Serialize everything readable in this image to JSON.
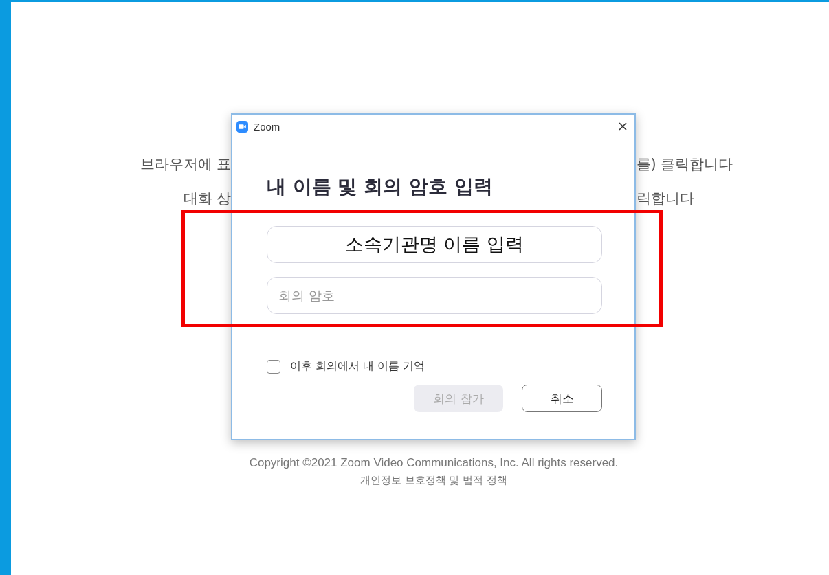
{
  "background": {
    "lines": [
      {
        "left": "브라우저에 표",
        "right": "를) 클릭합니다"
      },
      {
        "left": "대화 상",
        "right": "릭합니다"
      }
    ],
    "copyright": "Copyright ©2021 Zoom Video Communications, Inc. All rights reserved.",
    "policy_link": "개인정보 보호정책 및 법적 정책"
  },
  "dialog": {
    "title": "Zoom",
    "heading": "내 이름 및 회의 암호 입력",
    "name_field": {
      "value": "소속기관명 이름 입력"
    },
    "password_field": {
      "placeholder": "회의 암호"
    },
    "remember": {
      "label": "이후 회의에서 내 이름 기억",
      "checked": false
    },
    "buttons": [
      {
        "label": "회의 참가",
        "disabled": true
      },
      {
        "label": "취소",
        "disabled": false
      }
    ]
  },
  "highlight": {
    "shown": true
  }
}
